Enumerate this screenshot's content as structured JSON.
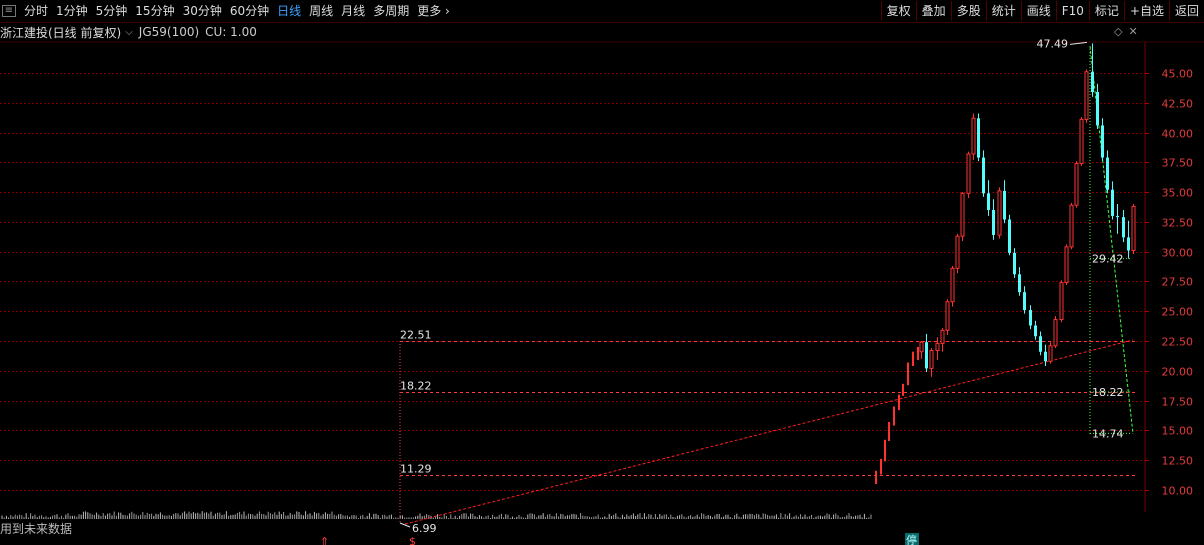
{
  "toolbar": {
    "tabs": [
      "分时",
      "1分钟",
      "5分钟",
      "15分钟",
      "30分钟",
      "60分钟",
      "日线",
      "周线",
      "月线",
      "多周期",
      "更多"
    ],
    "active_tab": "日线",
    "right_buttons": [
      "复权",
      "叠加",
      "多股",
      "统计",
      "画线",
      "F10",
      "标记",
      "+自选",
      "返回"
    ]
  },
  "info": {
    "stock_label": "浙江建投(日线 前复权)",
    "indicator": "JG59(100)",
    "cu": "CU: 1.00"
  },
  "future_note": "用到未来数据",
  "colors": {
    "up": "#ff3232",
    "down": "#54fcfc",
    "grid": "#7a0000",
    "fib": "#ff3a3a",
    "trend": "#ff2020",
    "fall": "#40ff40"
  },
  "chart_data": {
    "type": "candlestick",
    "y_ticks": [
      "45.00",
      "42.50",
      "40.00",
      "37.50",
      "35.00",
      "32.50",
      "30.00",
      "27.50",
      "25.00",
      "22.50",
      "20.00",
      "17.50",
      "15.00",
      "12.50",
      "10.00"
    ],
    "ylim": [
      8.6,
      48.5
    ],
    "annotations": {
      "fib_levels": [
        {
          "label": "22.51",
          "value": 22.51
        },
        {
          "label": "18.22",
          "value": 18.22
        },
        {
          "label": "11.29",
          "value": 11.29
        }
      ],
      "low_label": "6.99",
      "low_value": 6.99,
      "high_label": "47.49",
      "high_value": 47.49,
      "right_labels": [
        {
          "label": "29.42",
          "value": 29.42
        },
        {
          "label": "18.22",
          "value": 18.22
        },
        {
          "label": "14.74",
          "value": 14.74
        }
      ],
      "limit_marker": "停"
    },
    "candles": [
      [
        21.6,
        22.5,
        21.0,
        22.4
      ],
      [
        22.4,
        23.1,
        19.9,
        20.2
      ],
      [
        20.2,
        21.9,
        19.5,
        21.7
      ],
      [
        21.7,
        22.8,
        20.9,
        22.3
      ],
      [
        22.3,
        23.6,
        21.6,
        23.4
      ],
      [
        23.4,
        26.0,
        23.0,
        25.8
      ],
      [
        25.8,
        28.8,
        25.4,
        28.6
      ],
      [
        28.6,
        31.5,
        28.2,
        31.3
      ],
      [
        31.3,
        35.0,
        30.9,
        34.9
      ],
      [
        34.9,
        38.4,
        34.5,
        38.2
      ],
      [
        38.2,
        41.6,
        37.7,
        41.2
      ],
      [
        41.2,
        41.6,
        37.6,
        37.9
      ],
      [
        37.9,
        38.5,
        34.6,
        34.9
      ],
      [
        34.9,
        36.0,
        33.0,
        33.5
      ],
      [
        33.5,
        34.4,
        31.0,
        31.4
      ],
      [
        31.4,
        35.4,
        31.1,
        35.1
      ],
      [
        35.1,
        36.0,
        32.4,
        32.7
      ],
      [
        32.7,
        33.1,
        29.7,
        29.9
      ],
      [
        29.9,
        30.3,
        27.8,
        28.1
      ],
      [
        28.1,
        28.7,
        26.3,
        26.6
      ],
      [
        26.6,
        27.1,
        24.8,
        25.1
      ],
      [
        25.1,
        25.5,
        23.5,
        23.8
      ],
      [
        23.8,
        24.2,
        22.6,
        22.9
      ],
      [
        22.9,
        23.3,
        21.3,
        21.6
      ],
      [
        21.6,
        22.2,
        20.4,
        20.8
      ],
      [
        20.8,
        22.4,
        20.6,
        22.1
      ],
      [
        22.1,
        24.6,
        21.9,
        24.3
      ],
      [
        24.3,
        27.6,
        24.1,
        27.4
      ],
      [
        27.4,
        30.6,
        27.2,
        30.4
      ],
      [
        30.4,
        34.1,
        30.2,
        33.9
      ],
      [
        33.9,
        37.6,
        33.7,
        37.4
      ],
      [
        37.4,
        41.3,
        37.2,
        41.1
      ],
      [
        41.1,
        45.3,
        40.8,
        45.1
      ],
      [
        45.1,
        47.49,
        43.0,
        43.4
      ],
      [
        43.4,
        44.1,
        40.3,
        40.6
      ],
      [
        40.6,
        41.2,
        37.6,
        37.9
      ],
      [
        37.9,
        38.5,
        34.9,
        35.2
      ],
      [
        35.2,
        35.9,
        32.7,
        33.0
      ],
      [
        33.0,
        34.0,
        31.5,
        32.9
      ],
      [
        32.9,
        33.5,
        30.8,
        31.2
      ],
      [
        31.2,
        32.6,
        29.42,
        30.1
      ],
      [
        30.1,
        34.0,
        29.8,
        33.8
      ]
    ]
  }
}
